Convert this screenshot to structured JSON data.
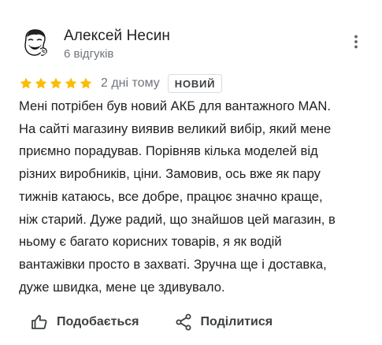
{
  "author": {
    "name": "Алексей Несин",
    "reviews_count": "6 відгуків",
    "avatar_icon": "meme-face-avatar-icon"
  },
  "menu": {
    "icon": "more-vertical-icon"
  },
  "rating": {
    "stars": 5,
    "max_stars": 5,
    "star_color": "#fbbc04",
    "date": "2 дні тому",
    "badge": "НОВИЙ"
  },
  "review": {
    "lines": [
      "Мені потрібен був новий АКБ для вантажного MAN.",
      "На сайті магазину виявив великий вибір, який мене",
      "приємно порадував. Порівняв кілька моделей від",
      "різних виробників, ціни. Замовив, ось вже як пару",
      "тижнів катаюсь, все добре, працює значно краще,",
      "ніж старий. Дуже радий, що знайшов цей магазин, в",
      "ньому є багато корисних товарів, я як водій",
      "вантажівки просто в захваті. Зручна ще і доставка,",
      "дуже швидка, мене це здивувало."
    ]
  },
  "actions": {
    "like_label": "Подобається",
    "like_icon": "thumb-up-icon",
    "share_label": "Поділитися",
    "share_icon": "share-icon"
  }
}
